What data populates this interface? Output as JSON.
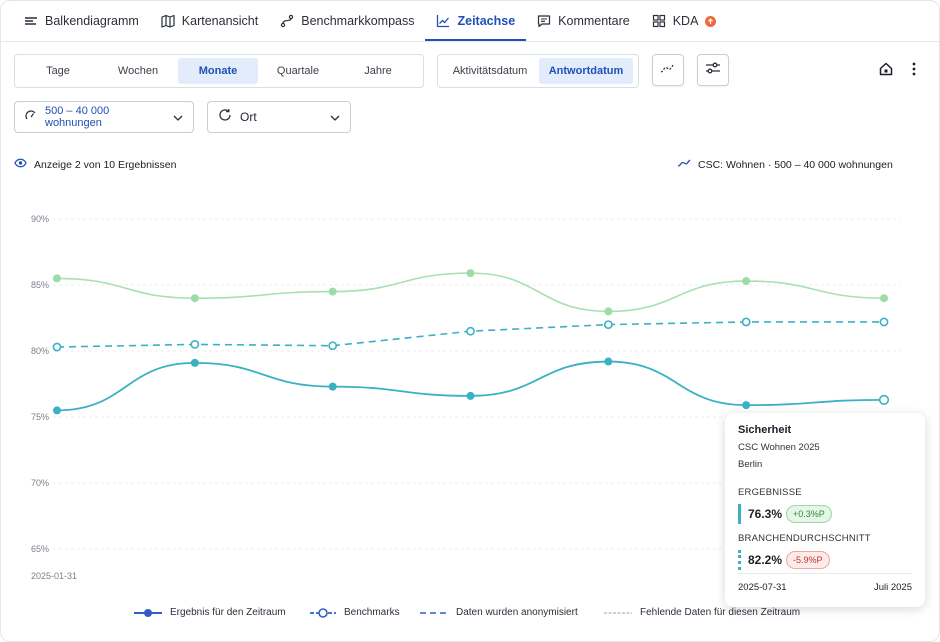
{
  "nav": {
    "tabs": [
      {
        "label": "Balkendiagramm",
        "icon": "bars-icon"
      },
      {
        "label": "Kartenansicht",
        "icon": "map-icon"
      },
      {
        "label": "Benchmarkkompass",
        "icon": "route-icon"
      },
      {
        "label": "Zeitachse",
        "icon": "line-chart-icon",
        "active": true
      },
      {
        "label": "Kommentare",
        "icon": "comment-icon"
      },
      {
        "label": "KDA",
        "icon": "grid-icon",
        "badge": "up-arrow-icon"
      }
    ]
  },
  "period": {
    "options": [
      "Tage",
      "Wochen",
      "Monate",
      "Quartale",
      "Jahre"
    ],
    "selected": "Monate"
  },
  "date_mode": {
    "options": [
      "Aktivitätsdatum",
      "Antwortdatum"
    ],
    "selected": "Antwortdatum"
  },
  "filters": {
    "size_label": "500 – 40 000 wohnungen",
    "location_label": "Ort"
  },
  "info": {
    "results_text": "Anzeige 2 von 10 Ergebnissen",
    "benchmark_text": "CSC: Wohnen · 500 – 40 000 wohnungen"
  },
  "colors": {
    "accent": "#1f4fb8",
    "result_line": "#3ab1c4",
    "benchmark_line": "#3ab1c4",
    "industry_line": "#9ddca6"
  },
  "chart_data": {
    "type": "line",
    "ylim": [
      65,
      90
    ],
    "yticks": [
      "90%",
      "85%",
      "80%",
      "75%",
      "70%",
      "65%"
    ],
    "ytick_values": [
      90,
      85,
      80,
      75,
      70,
      65
    ],
    "x_first_label": "2025-01-31",
    "n_points": 7,
    "series": [
      {
        "name": "Ergebnis für den Zeitraum",
        "style": "solid",
        "values": [
          75.5,
          79.1,
          77.3,
          76.6,
          79.2,
          75.9,
          76.3
        ]
      },
      {
        "name": "Benchmarks",
        "style": "dashed",
        "values": [
          80.3,
          80.5,
          80.4,
          81.5,
          82.0,
          82.2,
          82.2
        ]
      },
      {
        "style": "solid-light",
        "values": [
          85.5,
          84.0,
          84.5,
          85.9,
          83.0,
          85.3,
          84.0
        ]
      }
    ]
  },
  "tooltip": {
    "title": "Sicherheit",
    "subtitle": "CSC Wohnen 2025",
    "location": "Berlin",
    "results_heading": "ERGEBNISSE",
    "results_value": "76.3%",
    "results_delta": "+0.3%P",
    "industry_heading": "BRANCHENDURCHSCHNITT",
    "industry_value": "82.2%",
    "industry_delta": "-5.9%P",
    "date": "2025-07-31",
    "period": "Juli 2025"
  },
  "legend": {
    "result": "Ergebnis für den Zeitraum",
    "benchmark": "Benchmarks",
    "anonymized": "Daten wurden anonymisiert",
    "missing": "Fehlende Daten für diesen Zeitraum"
  }
}
